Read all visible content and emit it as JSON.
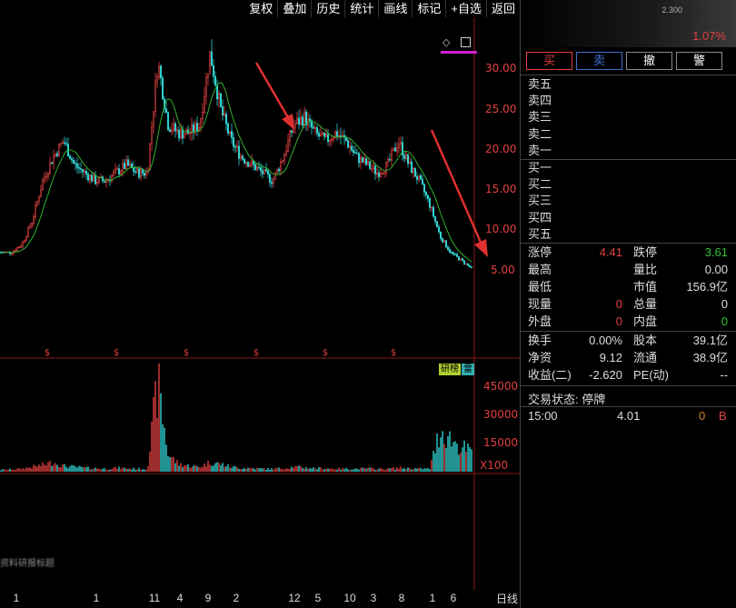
{
  "toolbar": {
    "buttons": [
      "复权",
      "叠加",
      "历史",
      "统计",
      "画线",
      "标记",
      "+自选",
      "返回"
    ]
  },
  "price_axis": {
    "labels": [
      "30.00",
      "25.00",
      "20.00",
      "15.00",
      "10.00",
      "5.00"
    ]
  },
  "volume_axis": {
    "labels": [
      "45000",
      "30000",
      "15000"
    ],
    "unit": "X100"
  },
  "chips": {
    "a": "研榜",
    "b": "雷"
  },
  "overlay_text": "资料研报标题",
  "x_axis": {
    "labels": [
      "1",
      "1",
      "11",
      "4",
      "9",
      "2",
      "12",
      "5",
      "10",
      "3",
      "8",
      "1",
      "6"
    ],
    "period": "日线"
  },
  "chart_data": {
    "type": "candlestick",
    "price_range": [
      3,
      33
    ],
    "volume_range": [
      0,
      50000
    ],
    "approx_close_path": [
      6,
      6,
      7,
      10,
      15,
      18,
      20,
      17,
      16,
      15,
      15,
      16,
      17,
      16,
      16,
      30,
      22,
      21,
      21,
      22,
      31,
      24,
      20,
      18,
      17,
      16,
      15,
      18,
      22,
      23,
      21,
      20,
      21,
      20,
      18,
      17,
      16,
      17,
      20,
      17,
      15,
      12,
      8,
      6,
      5,
      4
    ],
    "approx_volume_path": [
      1000,
      1200,
      1500,
      2500,
      3500,
      5000,
      3000,
      2500,
      2000,
      1800,
      1500,
      2000,
      1700,
      1500,
      1500,
      46000,
      9000,
      4000,
      3000,
      2500,
      5000,
      4000,
      2500,
      2000,
      1800,
      1500,
      1500,
      1800,
      2500,
      2200,
      1800,
      1700,
      1600,
      1500,
      1500,
      1700,
      1500,
      1500,
      2000,
      1800,
      1500,
      1500,
      22000,
      17000,
      13000,
      10000
    ]
  },
  "panel": {
    "price_tiny": "2.300",
    "price_pct": "1.07%",
    "trade_buttons": [
      "买",
      "卖",
      "撤",
      "警"
    ],
    "sell_levels": [
      "卖五",
      "卖四",
      "卖三",
      "卖二",
      "卖一"
    ],
    "buy_levels": [
      "买一",
      "买二",
      "买三",
      "买四",
      "买五"
    ],
    "stats1": [
      {
        "k1": "涨停",
        "v1": "4.41",
        "k2": "跌停",
        "v2": "3.61"
      },
      {
        "k1": "最高",
        "v1": "",
        "k2": "量比",
        "v2": "0.00"
      },
      {
        "k1": "最低",
        "v1": "",
        "k2": "市值",
        "v2": "156.9亿"
      },
      {
        "k1": "现量",
        "v1": "0",
        "k2": "总量",
        "v2": "0"
      },
      {
        "k1": "外盘",
        "v1": "0",
        "k2": "内盘",
        "v2": "0"
      }
    ],
    "stats2": [
      {
        "k1": "换手",
        "v1": "0.00%",
        "k2": "股本",
        "v2": "39.1亿"
      },
      {
        "k1": "净资",
        "v1": "9.12",
        "k2": "流通",
        "v2": "38.9亿"
      },
      {
        "k1": "收益(二)",
        "v1": "-2.620",
        "k2": "PE(动)",
        "v2": "--"
      }
    ],
    "status": "交易状态: 停牌",
    "tick": {
      "time": "15:00",
      "price": "4.01",
      "vol": "0",
      "side": "B"
    }
  },
  "colors": {
    "up": "#e04040",
    "down": "#30d0d0",
    "ma": "#30b030",
    "grid": "#8a1a1a",
    "arrow": "#e03030"
  }
}
